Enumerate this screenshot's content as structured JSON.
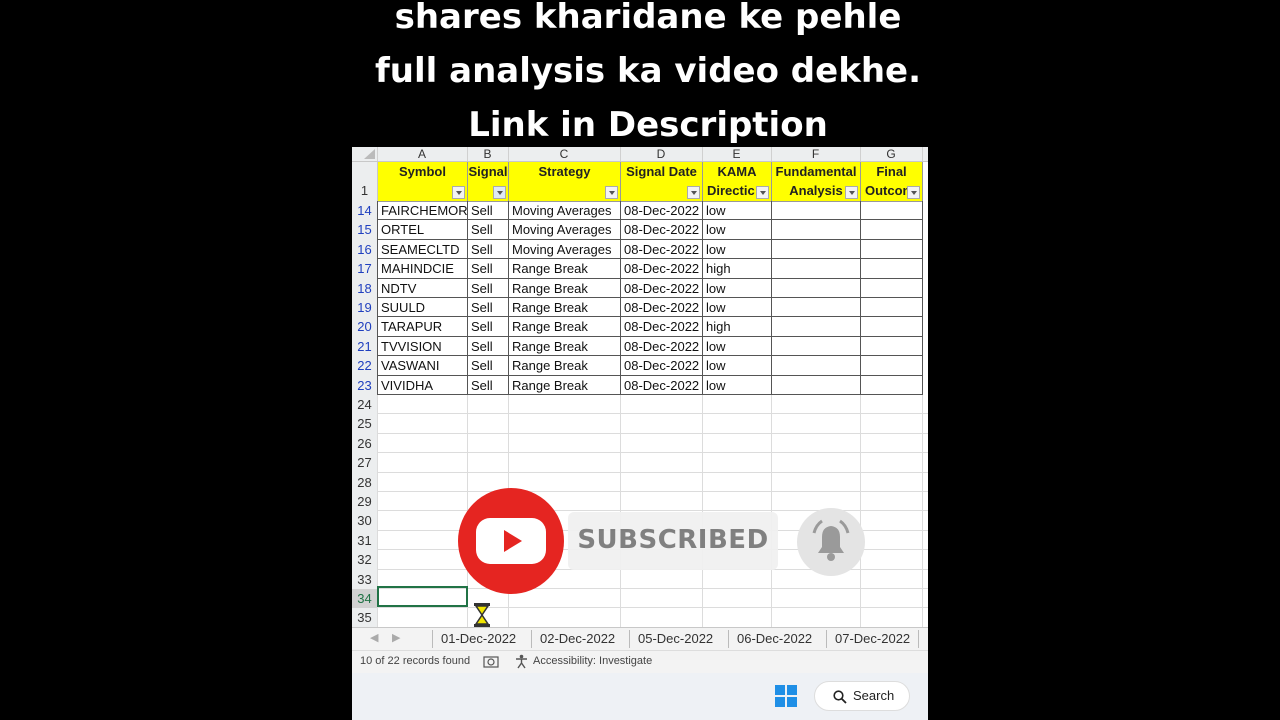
{
  "caption": {
    "line1": "shares kharidane ke pehle",
    "line2": "full analysis ka video dekhe.",
    "line3": "Link in Description"
  },
  "sheet": {
    "column_letters": [
      "A",
      "B",
      "C",
      "D",
      "E",
      "F",
      "G"
    ],
    "header_row_number": "1",
    "headers": [
      {
        "line1": "Symbol",
        "line2": ""
      },
      {
        "line1": "Signal",
        "line2": ""
      },
      {
        "line1": "Strategy",
        "line2": ""
      },
      {
        "line1": "Signal Date",
        "line2": ""
      },
      {
        "line1": "KAMA",
        "line2": "Directic"
      },
      {
        "line1": "Fundamental",
        "line2": "Analysis"
      },
      {
        "line1": "Final",
        "line2": "Outcon"
      }
    ],
    "rows": [
      {
        "num": "14",
        "symbol": "FAIRCHEMOR",
        "signal": "Sell",
        "strategy": "Moving Averages",
        "date": "08-Dec-2022",
        "kama": "low"
      },
      {
        "num": "15",
        "symbol": "ORTEL",
        "signal": "Sell",
        "strategy": "Moving Averages",
        "date": "08-Dec-2022",
        "kama": "low"
      },
      {
        "num": "16",
        "symbol": "SEAMECLTD",
        "signal": "Sell",
        "strategy": "Moving Averages",
        "date": "08-Dec-2022",
        "kama": "low"
      },
      {
        "num": "17",
        "symbol": "MAHINDCIE",
        "signal": "Sell",
        "strategy": "Range Break",
        "date": "08-Dec-2022",
        "kama": "high"
      },
      {
        "num": "18",
        "symbol": "NDTV",
        "signal": "Sell",
        "strategy": "Range Break",
        "date": "08-Dec-2022",
        "kama": "low"
      },
      {
        "num": "19",
        "symbol": "SUULD",
        "signal": "Sell",
        "strategy": "Range Break",
        "date": "08-Dec-2022",
        "kama": "low"
      },
      {
        "num": "20",
        "symbol": "TARAPUR",
        "signal": "Sell",
        "strategy": "Range Break",
        "date": "08-Dec-2022",
        "kama": "high"
      },
      {
        "num": "21",
        "symbol": "TVVISION",
        "signal": "Sell",
        "strategy": "Range Break",
        "date": "08-Dec-2022",
        "kama": "low"
      },
      {
        "num": "22",
        "symbol": "VASWANI",
        "signal": "Sell",
        "strategy": "Range Break",
        "date": "08-Dec-2022",
        "kama": "low"
      },
      {
        "num": "23",
        "symbol": "VIVIDHA",
        "signal": "Sell",
        "strategy": "Range Break",
        "date": "08-Dec-2022",
        "kama": "low"
      }
    ],
    "empty_rows": [
      "24",
      "25",
      "26",
      "27",
      "28",
      "29",
      "30",
      "31",
      "32",
      "33",
      "34",
      "35"
    ],
    "selected_row": "34",
    "tabs": [
      "01-Dec-2022",
      "02-Dec-2022",
      "05-Dec-2022",
      "06-Dec-2022",
      "07-Dec-2022"
    ],
    "status_records": "10 of 22 records found",
    "status_accessibility": "Accessibility: Investigate"
  },
  "overlay": {
    "subscribed_label": "SUBSCRIBED"
  },
  "taskbar": {
    "search_label": "Search"
  },
  "colors": {
    "header_fill": "#ffff00",
    "row_number_blue": "#1f3fbf",
    "youtube_red": "#e52521",
    "excel_green": "#217346"
  },
  "icons": [
    "filter-icon",
    "dropdown-icon",
    "youtube-play-icon",
    "bell-icon",
    "hourglass-icon",
    "windows-logo-icon",
    "search-icon",
    "accessibility-icon",
    "macro-record-icon"
  ]
}
